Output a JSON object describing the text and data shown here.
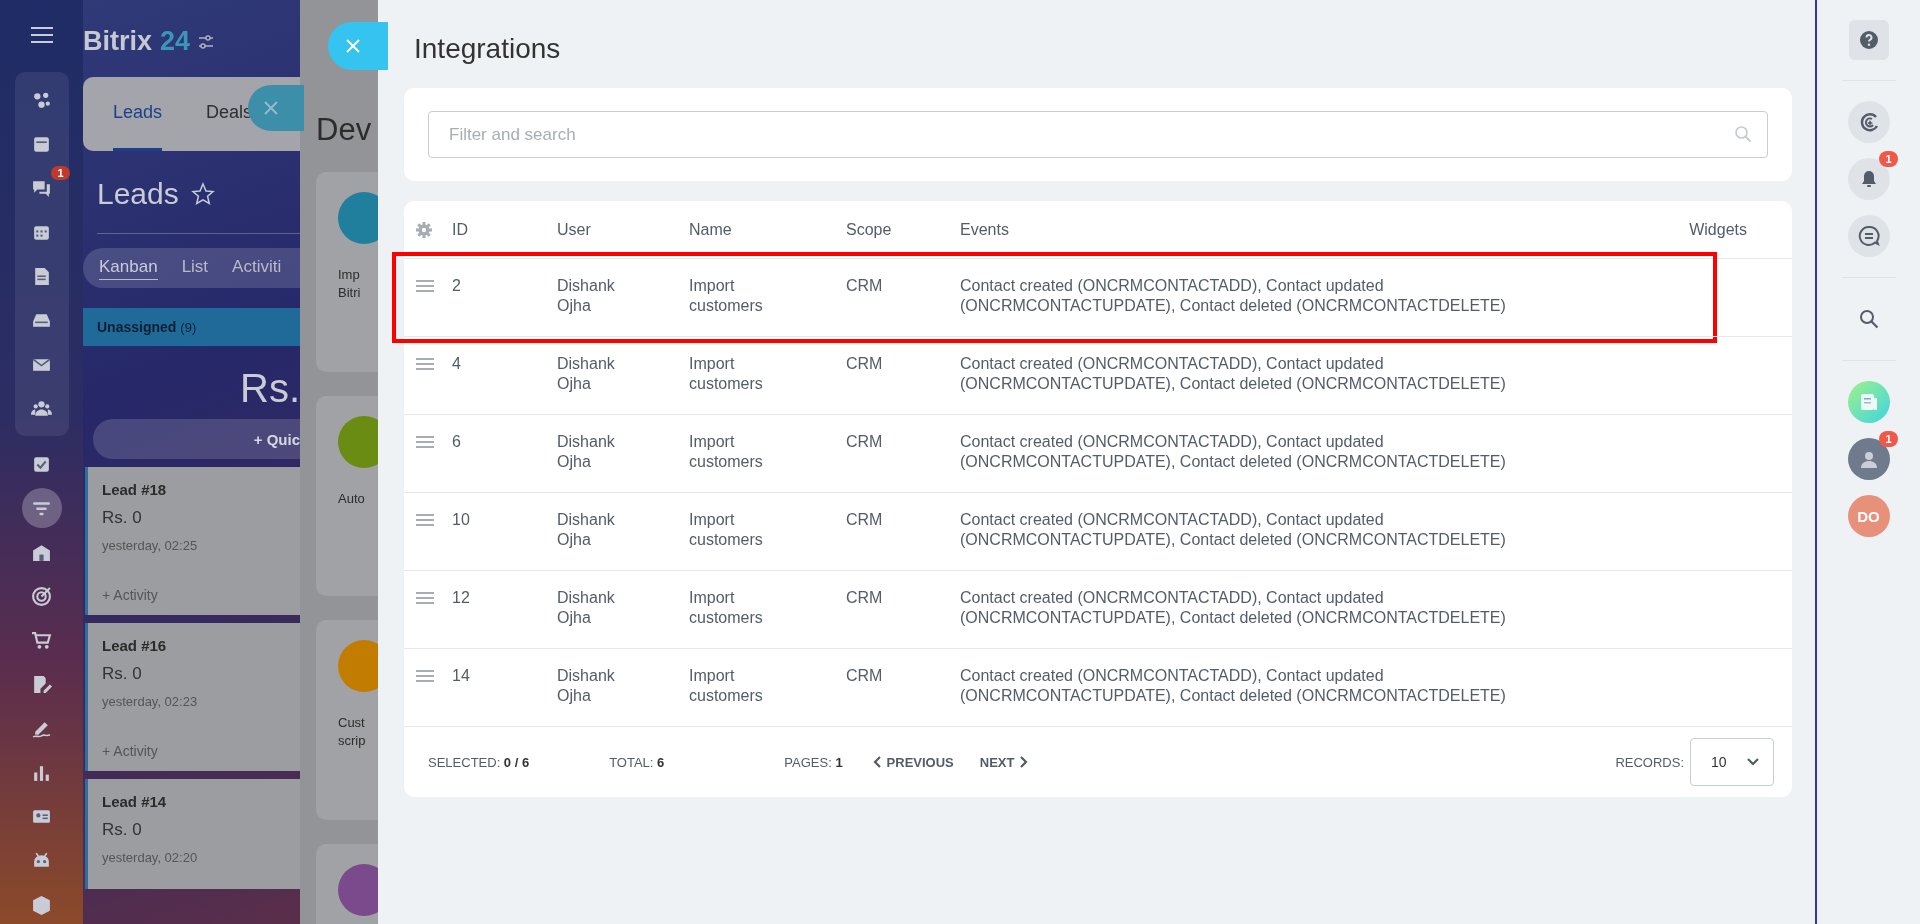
{
  "nav": {
    "pinned_group": [
      {
        "selected": false
      },
      {
        "selected": false
      },
      {
        "selected": false,
        "badge": "1"
      },
      {
        "selected": false
      },
      {
        "selected": false
      },
      {
        "selected": false
      },
      {
        "selected": false
      },
      {
        "selected": false
      }
    ],
    "items": [
      {
        "selected": false
      },
      {
        "selected": true
      },
      {
        "selected": false
      },
      {
        "selected": false
      },
      {
        "selected": false
      },
      {
        "selected": false
      },
      {
        "selected": false
      },
      {
        "selected": false
      },
      {
        "selected": false
      },
      {
        "selected": false
      },
      {
        "selected": false
      }
    ]
  },
  "crm": {
    "logo": {
      "name": "Bitrix",
      "suffix": "24"
    },
    "tabs": [
      {
        "label": "Leads",
        "selected": true
      },
      {
        "label": "Deals",
        "selected": false
      }
    ],
    "title": "Leads",
    "views": [
      {
        "label": "Kanban",
        "selected": true
      },
      {
        "label": "List",
        "selected": false
      },
      {
        "label": "Activiti",
        "selected": false
      }
    ],
    "column": {
      "name": "Unassigned",
      "count": "(9)",
      "total": "Rs.",
      "quick_add": "+ Quic"
    },
    "cards": [
      {
        "title": "Lead #18",
        "amount": "Rs. 0",
        "time": "yesterday, 02:25",
        "activity": "+ Activity"
      },
      {
        "title": "Lead #16",
        "amount": "Rs. 0",
        "time": "yesterday, 02:23",
        "activity": "+ Activity"
      },
      {
        "title": "Lead #14",
        "amount": "Rs. 0",
        "time": "yesterday, 02:20"
      }
    ]
  },
  "developer_panel": {
    "title": "Dev",
    "cards": [
      {
        "color": "#1f7f9c",
        "lines": [
          "Imp",
          "Bitri"
        ]
      },
      {
        "color": "#6b8c12",
        "lines": [
          "Auto"
        ]
      },
      {
        "color": "#c27c00",
        "lines": [
          "Cust",
          "scrip"
        ]
      },
      {
        "color": "#7b4a8c"
      }
    ]
  },
  "integrations": {
    "title": "Integrations",
    "search": {
      "placeholder": "Filter and search"
    },
    "table": {
      "columns": [
        "ID",
        "User",
        "Name",
        "Scope",
        "Events",
        "Widgets"
      ],
      "rows": [
        {
          "id": "2",
          "user": "Dishank Ojha",
          "name": "Import customers",
          "scope": "CRM",
          "events": "Contact created (ONCRMCONTACTADD), Contact updated (ONCRMCONTACTUPDATE), Contact deleted (ONCRMCONTACTDELETE)",
          "highlighted": true
        },
        {
          "id": "4",
          "user": "Dishank Ojha",
          "name": "Import customers",
          "scope": "CRM",
          "events": "Contact created (ONCRMCONTACTADD), Contact updated (ONCRMCONTACTUPDATE), Contact deleted (ONCRMCONTACTDELETE)",
          "highlighted": false
        },
        {
          "id": "6",
          "user": "Dishank Ojha",
          "name": "Import customers",
          "scope": "CRM",
          "events": "Contact created (ONCRMCONTACTADD), Contact updated (ONCRMCONTACTUPDATE), Contact deleted (ONCRMCONTACTDELETE)",
          "highlighted": false
        },
        {
          "id": "10",
          "user": "Dishank Ojha",
          "name": "Import customers",
          "scope": "CRM",
          "events": "Contact created (ONCRMCONTACTADD), Contact updated (ONCRMCONTACTUPDATE), Contact deleted (ONCRMCONTACTDELETE)",
          "highlighted": false
        },
        {
          "id": "12",
          "user": "Dishank Ojha",
          "name": "Import customers",
          "scope": "CRM",
          "events": "Contact created (ONCRMCONTACTADD), Contact updated (ONCRMCONTACTUPDATE), Contact deleted (ONCRMCONTACTDELETE)",
          "highlighted": false
        },
        {
          "id": "14",
          "user": "Dishank Ojha",
          "name": "Import customers",
          "scope": "CRM",
          "events": "Contact created (ONCRMCONTACTADD), Contact updated (ONCRMCONTACTUPDATE), Contact deleted (ONCRMCONTACTDELETE)",
          "highlighted": false
        }
      ]
    },
    "footer": {
      "selected": "SELECTED: **0 / 6**",
      "total": "TOTAL: **6**",
      "pages": "PAGES: **1**",
      "previous": "PREVIOUS",
      "next": "NEXT",
      "records_label": "RECORDS:",
      "records_value": "10"
    }
  },
  "right_rail": [
    {
      "kind": "help"
    },
    {
      "kind": "copilot"
    },
    {
      "kind": "bell",
      "badge": "1"
    },
    {
      "kind": "chat"
    },
    {
      "kind": "search"
    },
    {
      "kind": "news"
    },
    {
      "kind": "avatar",
      "badge": "1"
    },
    {
      "kind": "initials",
      "text": "DO"
    }
  ]
}
